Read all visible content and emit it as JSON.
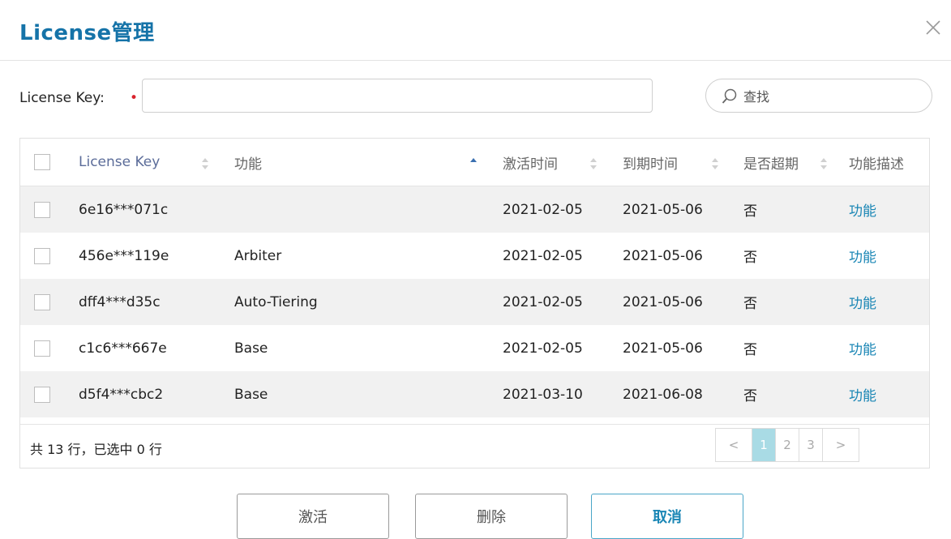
{
  "dialog": {
    "title": "License管理"
  },
  "form": {
    "key_label": "License Key:",
    "required_mark": "•",
    "key_value": "",
    "search_placeholder": "查找"
  },
  "table": {
    "headers": {
      "key": "License Key",
      "function": "功能",
      "activated": "激活时间",
      "expires": "到期时间",
      "expired": "是否超期",
      "description": "功能描述"
    },
    "rows": [
      {
        "key": "6e16***071c",
        "function": "",
        "activated": "2021-02-05",
        "expires": "2021-05-06",
        "expired": "否",
        "description": "功能"
      },
      {
        "key": "456e***119e",
        "function": "Arbiter",
        "activated": "2021-02-05",
        "expires": "2021-05-06",
        "expired": "否",
        "description": "功能"
      },
      {
        "key": "dff4***d35c",
        "function": "Auto-Tiering",
        "activated": "2021-02-05",
        "expires": "2021-05-06",
        "expired": "否",
        "description": "功能"
      },
      {
        "key": "c1c6***667e",
        "function": "Base",
        "activated": "2021-02-05",
        "expires": "2021-05-06",
        "expired": "否",
        "description": "功能"
      },
      {
        "key": "d5f4***cbc2",
        "function": "Base",
        "activated": "2021-03-10",
        "expires": "2021-06-08",
        "expired": "否",
        "description": "功能"
      }
    ],
    "summary": "共 13 行，已选中 0 行"
  },
  "pagination": {
    "prev": "<",
    "pages": [
      "1",
      "2",
      "3"
    ],
    "current": "1",
    "next": ">"
  },
  "buttons": {
    "activate": "激活",
    "delete": "删除",
    "cancel": "取消"
  },
  "colors": {
    "title": "#1573a8",
    "link": "#1a86b5",
    "required": "#d9232d",
    "active_page": "#a9dbe5"
  }
}
